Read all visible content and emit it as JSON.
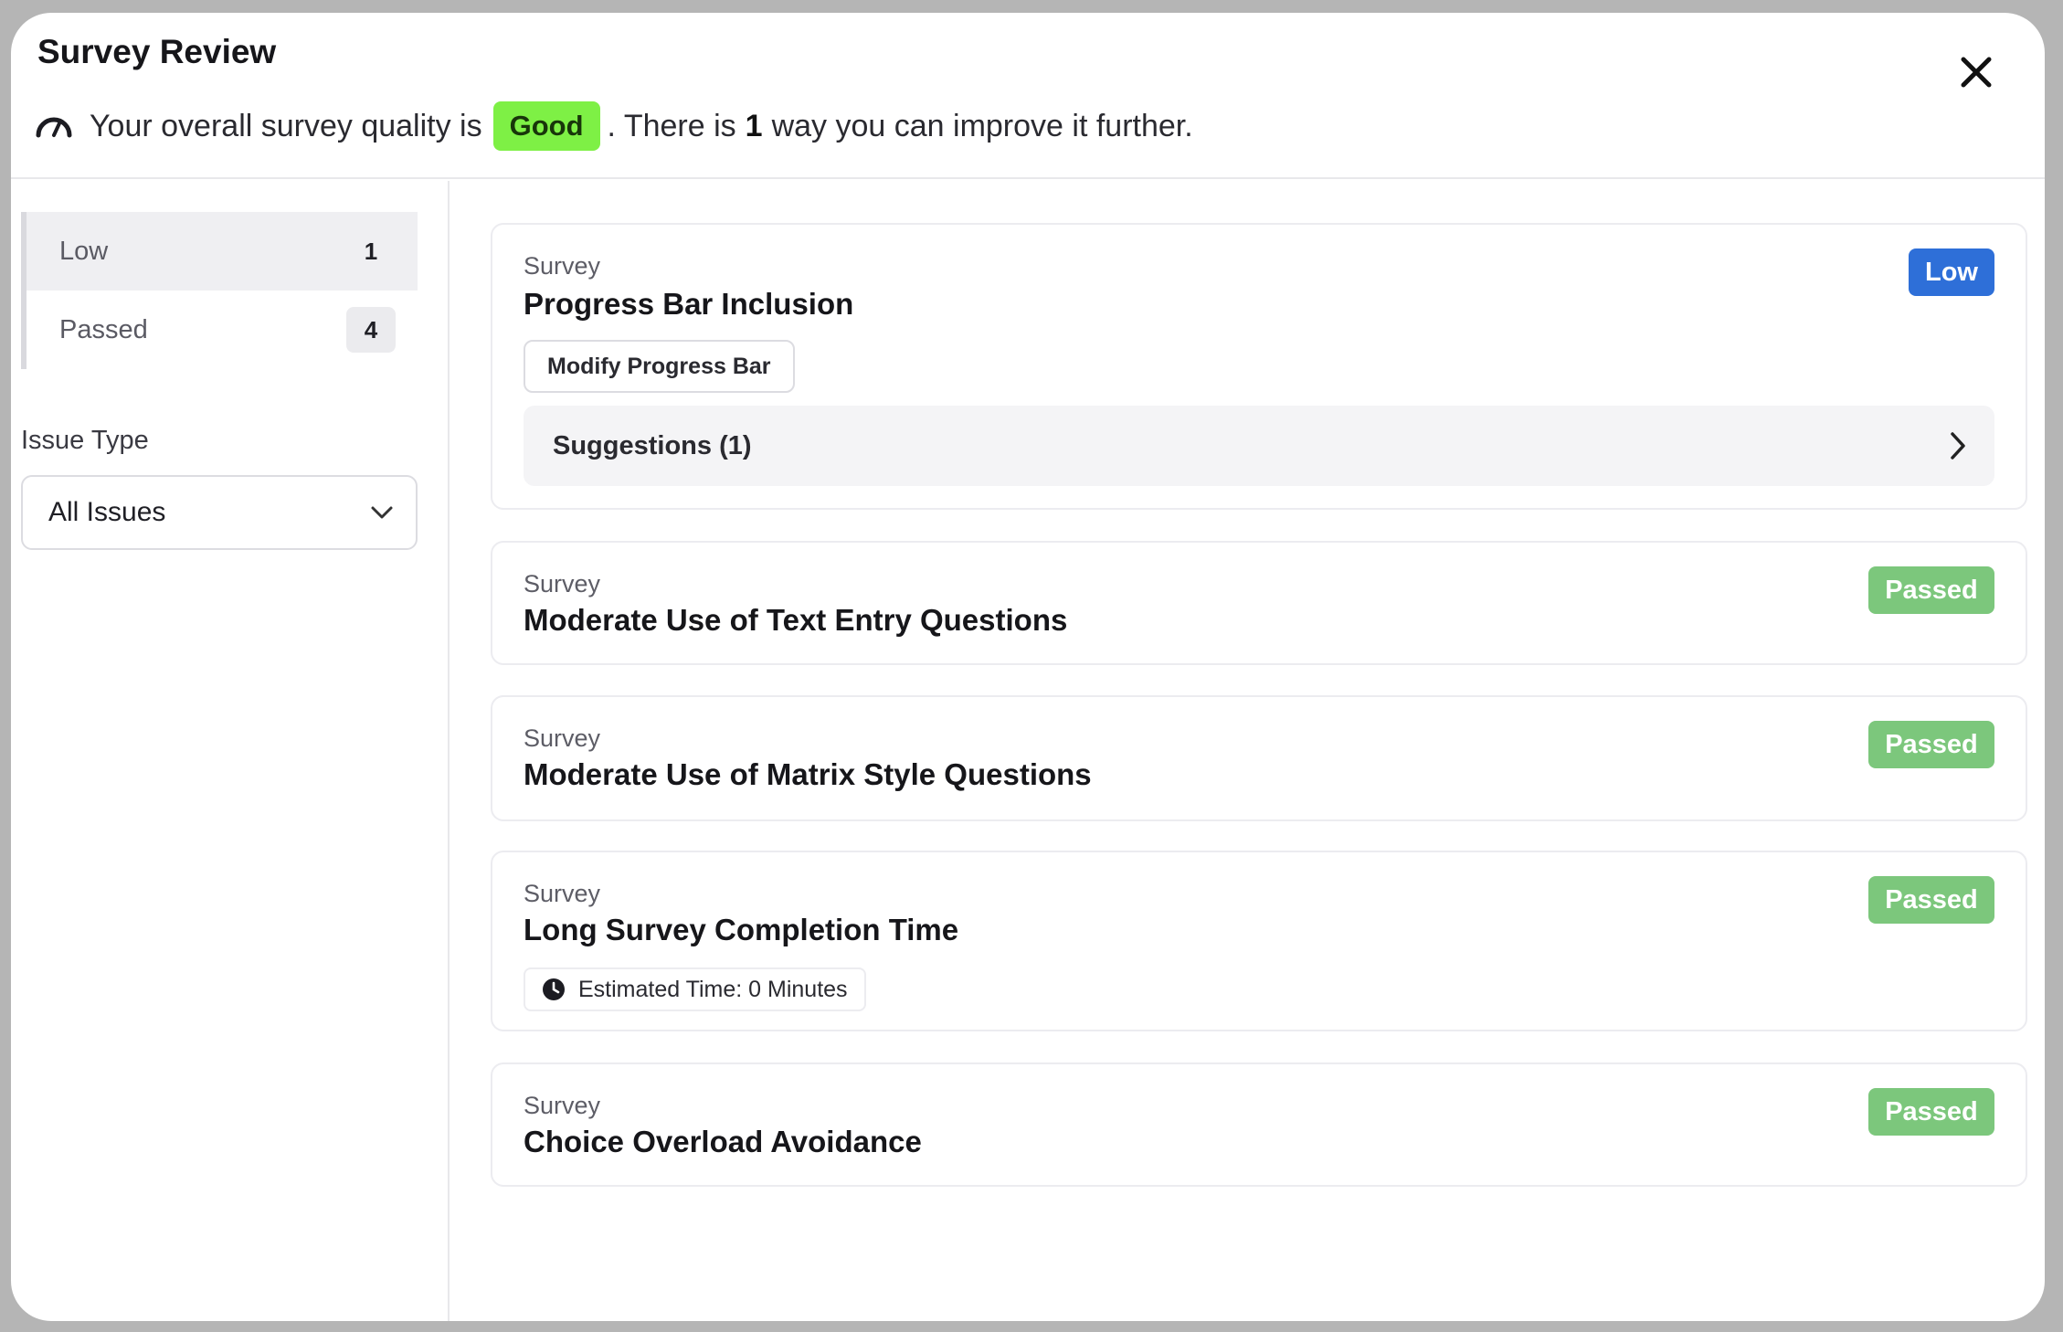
{
  "header": {
    "title": "Survey Review",
    "quality_prefix": "Your overall survey quality is",
    "quality_value": "Good",
    "quality_middle": ". There is",
    "improve_count": "1",
    "quality_suffix": "way you can improve it further."
  },
  "sidebar": {
    "filters": [
      {
        "label": "Low",
        "count": "1"
      },
      {
        "label": "Passed",
        "count": "4"
      }
    ],
    "issue_type_label": "Issue Type",
    "issue_type_value": "All Issues"
  },
  "cards": [
    {
      "category": "Survey",
      "name": "Progress Bar Inclusion",
      "badge": "Low",
      "action": "Modify Progress Bar",
      "suggestions": "Suggestions (1)"
    },
    {
      "category": "Survey",
      "name": "Moderate Use of Text Entry Questions",
      "badge": "Passed"
    },
    {
      "category": "Survey",
      "name": "Moderate Use of Matrix Style Questions",
      "badge": "Passed"
    },
    {
      "category": "Survey",
      "name": "Long Survey Completion Time",
      "badge": "Passed",
      "chip": "Estimated Time: 0 Minutes"
    },
    {
      "category": "Survey",
      "name": "Choice Overload Avoidance",
      "badge": "Passed"
    }
  ],
  "colors": {
    "good": "#7ef045",
    "low": "#2e6fd8",
    "passed": "#7cc77c"
  },
  "icons": {
    "quality": "gauge-icon",
    "close": "close-icon",
    "dropdown": "chevron-down-icon",
    "suggestions": "chevron-right-icon",
    "time": "clock-icon"
  }
}
